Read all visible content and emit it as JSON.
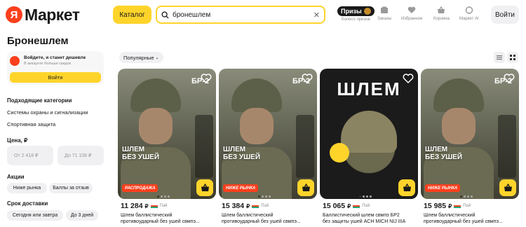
{
  "header": {
    "logo_mark": "Я",
    "logo_text": "Маркет",
    "catalog_label": "Каталог",
    "search_value": "бронешлем",
    "prizes_label": "Призы",
    "prizes_sub": "Колесо призов",
    "orders": "Заказы",
    "favorites": "Избранное",
    "cart": "Корзина",
    "market_ai": "Маркет AI",
    "login": "Войти"
  },
  "sidebar": {
    "title": "Бронешлем",
    "login_card": {
      "title": "Войдите, и станет дешевле",
      "subtitle": "В аккаунте больше скидок",
      "button": "Войти"
    },
    "categories_header": "Подходящие категории",
    "categories": [
      "Системы охраны и сигнализации",
      "Спортивная защита"
    ],
    "price_header": "Цена, ₽",
    "price_from": "От 2 418 ₽",
    "price_to": "До 71 108 ₽",
    "promo_header": "Акции",
    "promo_chips": [
      "Ниже рынка",
      "Баллы за отзыв"
    ],
    "delivery_header": "Срок доставки",
    "delivery_chips": [
      "Сегодня или завтра",
      "До 3 дней"
    ]
  },
  "toolbar": {
    "sort_label": "Популярные"
  },
  "products": [
    {
      "price": "11 284",
      "currency": "₽",
      "seller": "Пэй",
      "title1": "Шлем баллистический",
      "title2": "противоударный без ушей свмпэ...",
      "badge": "РАСПРОДАЖА",
      "image_caption": "ШЛЕМ\nБЕЗ УШЕЙ",
      "image_tag": "БР-2",
      "dark_bg": "#3b3a2c"
    },
    {
      "price": "15 384",
      "currency": "₽",
      "seller": "Пэй",
      "title1": "Шлем баллистический",
      "title2": "противоударный без ушей свмпэ...",
      "badge": "НИЖЕ РЫНКА",
      "image_caption": "ШЛЕМ\nБЕЗ УШЕЙ",
      "image_tag": "БР-2",
      "dark_bg": "#3e3d30"
    },
    {
      "price": "15 065",
      "currency": "₽",
      "seller": "Пэй",
      "title1": "Баллистический шлем свмпэ БР2",
      "title2": "без защиты ушей ACH MICH NIJ IIIA",
      "badge": "",
      "image_caption": "ШЛЕМ",
      "image_tag": "",
      "dark_bg": "#1b1b1b"
    },
    {
      "price": "15 985",
      "currency": "₽",
      "seller": "Пэй",
      "title1": "Шлем баллистический",
      "title2": "противоударный без ушей свмпэ...",
      "badge": "НИЖЕ РЫНКА",
      "image_caption": "ШЛЕМ\nБЕЗ УШЕЙ",
      "image_tag": "БР-2",
      "dark_bg": "#3e3d30"
    }
  ],
  "colors": {
    "accent_yellow": "#fed42b",
    "brand_red": "#fc3f1d"
  }
}
